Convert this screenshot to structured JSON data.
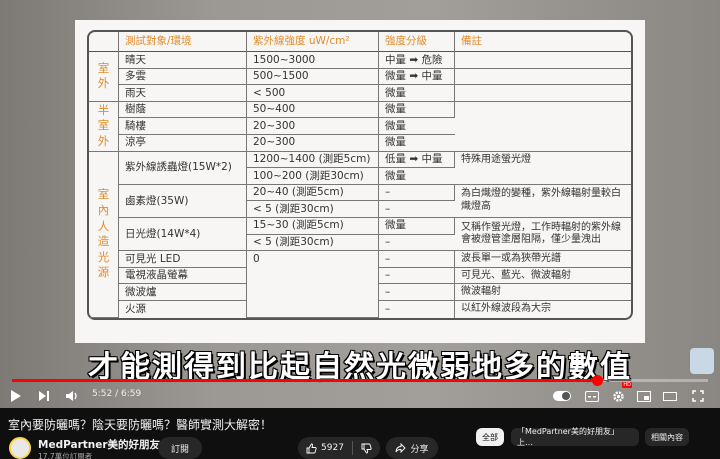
{
  "slide_table": {
    "headers": {
      "object": "測試對象/環境",
      "intensity": "紫外線強度 uW/cm²",
      "level": "強度分級",
      "remarks": "備註"
    },
    "groups": {
      "outdoor": "室\n外",
      "semi_outdoor": "半\n室\n外",
      "indoor_artificial": "室\n內\n人\n造\n光\n源"
    },
    "rows": [
      {
        "object": "晴天",
        "intensity": "1500~3000",
        "level": "中量 ➡ 危險",
        "remarks": ""
      },
      {
        "object": "多雲",
        "intensity": "500~1500",
        "level": "微量 ➡ 中量",
        "remarks": ""
      },
      {
        "object": "雨天",
        "intensity": "< 500",
        "level": "微量",
        "remarks": ""
      },
      {
        "object": "樹蔭",
        "intensity": "50~400",
        "level": "微量",
        "remarks": ""
      },
      {
        "object": "騎樓",
        "intensity": "20~300",
        "level": "微量",
        "remarks": ""
      },
      {
        "object": "涼亭",
        "intensity": "20~300",
        "level": "微量",
        "remarks": ""
      },
      {
        "object": "紫外線誘蟲燈(15W*2)",
        "intensity": "1200~1400 (測距5cm)",
        "level": "低量 ➡ 中量",
        "remarks": "特殊用途螢光燈"
      },
      {
        "object": "",
        "intensity": "100~200 (測距30cm)",
        "level": "微量",
        "remarks": ""
      },
      {
        "object": "鹵素燈(35W)",
        "intensity": "20~40 (測距5cm)",
        "level": "–",
        "remarks": "為白熾燈的變種，紫外線輻射量較白熾燈高"
      },
      {
        "object": "",
        "intensity": "< 5 (測距30cm)",
        "level": "–",
        "remarks": ""
      },
      {
        "object": "日光燈(14W*4)",
        "intensity": "15~30 (測距5cm)",
        "level": "微量",
        "remarks": "又稱作螢光燈，工作時輻射的紫外線會被燈管塗層阻隔，僅少量洩出"
      },
      {
        "object": "",
        "intensity": "< 5 (測距30cm)",
        "level": "–",
        "remarks": ""
      },
      {
        "object": "可見光 LED",
        "intensity": "0",
        "level": "–",
        "remarks": "波長單一或為狹帶光譜"
      },
      {
        "object": "電視液晶螢幕",
        "intensity": "",
        "level": "–",
        "remarks": "可見光、藍光、微波輻射"
      },
      {
        "object": "微波爐",
        "intensity": "",
        "level": "–",
        "remarks": "微波輻射"
      },
      {
        "object": "火源",
        "intensity": "",
        "level": "–",
        "remarks": "以紅外線波段為大宗"
      }
    ]
  },
  "subtitle": "才能測得到比起自然光微弱地多的數值",
  "player": {
    "time": "5:52 / 6:59",
    "progress": 0.84
  },
  "video": {
    "title": "室內要防曬嗎？陰天要防曬嗎？醫師實測大解密！",
    "channel": "MedPartner美的好朋友",
    "subscribers": "17.7萬位訂閱者",
    "subscribe_label": "訂閱",
    "likes": "5927",
    "share_label": "分享"
  },
  "chips": [
    "全部",
    "「MedPartner美的好朋友」上…",
    "相關內容"
  ]
}
